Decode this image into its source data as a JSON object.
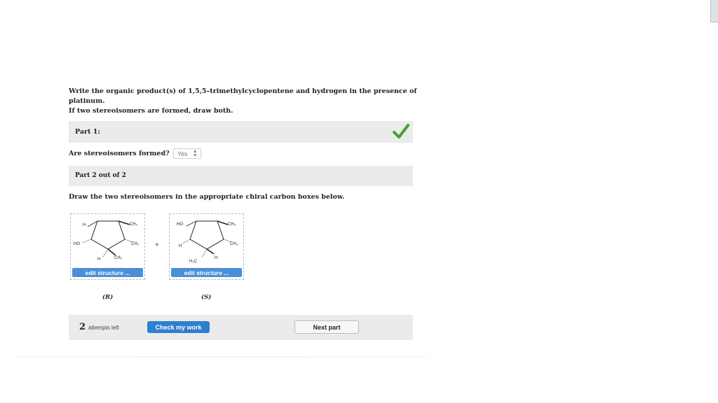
{
  "question": {
    "line1": "Write the organic product(s) of 1,5,5–trimethylcyclopentene and hydrogen in the presence of platinum.",
    "line2": "If two stereoisomers are formed, draw both."
  },
  "part1": {
    "title": "Part 1:",
    "status": "correct"
  },
  "stereo": {
    "question": "Are stereoisomers formed?",
    "selected": "Yes"
  },
  "part2": {
    "title": "Part 2 out of 2"
  },
  "instructions": "Draw the two stereoisomers in the appropriate chiral carbon boxes below.",
  "structures": [
    {
      "atoms": {
        "top_left": "H",
        "top_right": "CH₃",
        "left": "HO",
        "right": "CH₃",
        "bottom_left": "H",
        "bottom_right": "CH₃"
      },
      "button": "edit structure ...",
      "label": "(R)"
    },
    {
      "atoms": {
        "top_left": "HO",
        "top_right": "CH₃",
        "left": "H",
        "right": "CH₃",
        "bottom_left": "H₃C",
        "bottom_right": "H"
      },
      "button": "edit structure ...",
      "label": "(S)"
    }
  ],
  "plus_sign": "+",
  "footer": {
    "attempts_count": "2",
    "attempts_text": "attempts left",
    "check_button": "Check my work",
    "next_button": "Next part"
  },
  "colors": {
    "accent": "#2f7fd0",
    "check": "#4aa02c",
    "bar": "#ebebeb"
  }
}
